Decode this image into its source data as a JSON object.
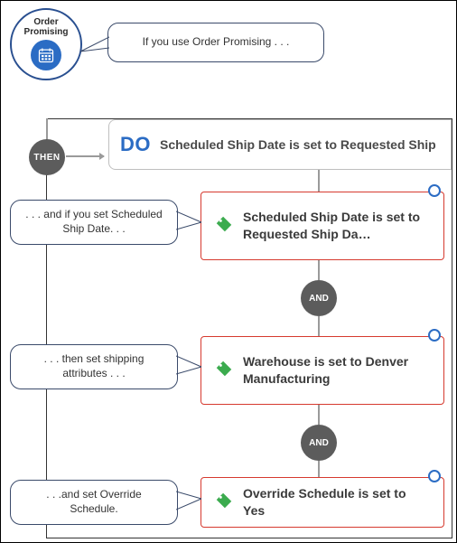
{
  "order_promising": {
    "label": "Order\nPromising"
  },
  "bubbles": {
    "top": "If you use Order Promising . . .",
    "b1": ". . . and if you set Scheduled Ship Date. . .",
    "b2": ". . . then set shipping attributes . . .",
    "b3": ". . .and set Override Schedule."
  },
  "then_label": "THEN",
  "do": {
    "word": "DO",
    "title": "Scheduled Ship Date is set to Requested Ship"
  },
  "actions": {
    "a1": "Scheduled Ship Date is set to Requested Ship Da…",
    "a2": "Warehouse is set to Denver Manufacturing",
    "a3": "Override Schedule is set to Yes"
  },
  "and_label": "AND",
  "colors": {
    "accent_blue": "#2b6cc4",
    "action_border": "#d63a2f",
    "tag_green": "#3bab4e"
  }
}
